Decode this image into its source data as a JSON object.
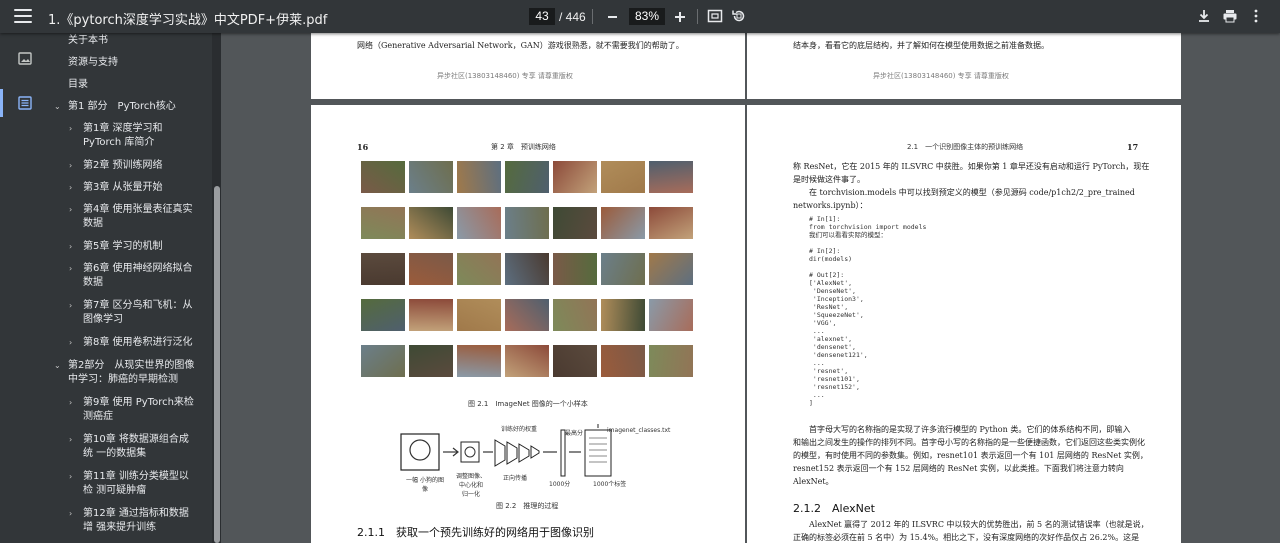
{
  "toolbar": {
    "title": "1.《pytorch深度学习实战》中文PDF+伊莱.pdf",
    "page_current": "43",
    "page_total": "/ 446",
    "zoom": "83%"
  },
  "outline": {
    "items": [
      {
        "label": "关于本书",
        "chevron": "",
        "level": 0
      },
      {
        "label": "资源与支持",
        "chevron": "",
        "level": 0
      },
      {
        "label": "目录",
        "chevron": "",
        "level": 0
      },
      {
        "label": "第1 部分　PyTorch核心",
        "chevron": "⌄",
        "level": 0
      },
      {
        "label": "第1章 深度学习和PyTorch 库简介",
        "chevron": "›",
        "level": 1
      },
      {
        "label": "第2章 预训练网络",
        "chevron": "›",
        "level": 1
      },
      {
        "label": "第3章 从张量开始",
        "chevron": "›",
        "level": 1
      },
      {
        "label": "第4章 使用张量表征真实 数据",
        "chevron": "›",
        "level": 1
      },
      {
        "label": "第5章 学习的机制",
        "chevron": "›",
        "level": 1
      },
      {
        "label": "第6章 使用神经网络拟合 数据",
        "chevron": "›",
        "level": 1
      },
      {
        "label": "第7章 区分鸟和飞机：从 图像学习",
        "chevron": "›",
        "level": 1
      },
      {
        "label": "第8章 使用卷积进行泛化",
        "chevron": "›",
        "level": 1
      },
      {
        "label": "第2部分　从现实世界的图像 中学习：肺癌的早期检测",
        "chevron": "⌄",
        "level": 0
      },
      {
        "label": "第9章 使用 PyTorch来检 测癌症",
        "chevron": "›",
        "level": 1
      },
      {
        "label": "第10章 将数据源组合成统 一的数据集",
        "chevron": "›",
        "level": 1
      },
      {
        "label": "第11章 训练分类模型以检 测可疑肿瘤",
        "chevron": "›",
        "level": 1
      },
      {
        "label": "第12章 通过指标和数据增 强来提升训练",
        "chevron": "›",
        "level": 1
      }
    ]
  },
  "pages": {
    "top_left_text": "网络（Generative Adversarial Network，GAN）游戏很熟悉，就不需要我们的帮助了。",
    "top_left_footer": "异步社区(13803148460) 专享 请尊重版权",
    "top_right_text": "结本身，看看它的底层结构，并了解如何在模型使用数据之前准备数据。",
    "top_right_footer": "异步社区(13803148460) 专享 请尊重版权",
    "left": {
      "page_number": "16",
      "header": "第 2 章　预训练网络",
      "fig1_caption": "图 2.1　ImageNet 图像的一个小样本",
      "fig2_caption": "图 2.2　推理的过程",
      "fig2_labels": [
        "训练好的权重",
        "最高分",
        "imagenet_classes.txt",
        "一幅 小狗的图像",
        "调整图像、 中心化和 归一化",
        "正向传播",
        "1000分",
        "1000个标签"
      ],
      "section": "2.1.1　获取一个预先训练好的网络用于图像识别"
    },
    "right": {
      "page_number": "17",
      "header": "2.1　一个识别图像主体的预训练网络",
      "intro_lines": [
        "称 ResNet，它在 2015 年的 ILSVRC 中获胜。如果你第 1 章早还没有启动和运行 PyTorch，现在",
        "是时候做这件事了。",
        "　　在 torchvision.models 中可以找到预定义的模型（参见源码 code/p1ch2/2_pre_trained",
        "networks.ipynb）："
      ],
      "code_block": "# In[1]:\nfrom torchvision import models\n我们可以看看实际的模型：\n\n# In[2]:\ndir(models)\n\n# Out[2]:\n['AlexNet',\n 'DenseNet',\n 'Inception3',\n 'ResNet',\n 'SqueezeNet',\n 'VGG',\n ...\n 'alexnet',\n 'densenet',\n 'densenet121',\n ...\n 'resnet',\n 'resnet101',\n 'resnet152',\n ...\n]",
      "para_lines": [
        "　　首字母大写的名称指的是实现了许多流行模型的 Python 类。它们的体系结构不同，即输入",
        "和输出之间发生的操作的排列不同。首字母小写的名称指的是一些便捷函数，它们返回这些类实例化",
        "的模型，有时使用不同的参数集。例如，resnet101 表示返回一个有 101 层网络的 ResNet 实例，",
        "resnet152 表示返回一个有 152 层网络的 ResNet 实例，以此类推。下面我们将注意力转向",
        "AlexNet。"
      ],
      "section": "2.1.2　AlexNet",
      "tail_lines": [
        "　　AlexNet 赢得了 2012 年的 ILSVRC 中以较大的优势胜出，前 5 名的测试错误率（也就是说，",
        "正确的标签必须在前 5 名中）为 15.4%。相比之下，没有深度网络的次好作品仅占 26.2%。这是"
      ]
    }
  },
  "colors": {
    "toolbar": "#323639",
    "viewer_bg": "#525659",
    "accent": "#8ab4f8"
  }
}
